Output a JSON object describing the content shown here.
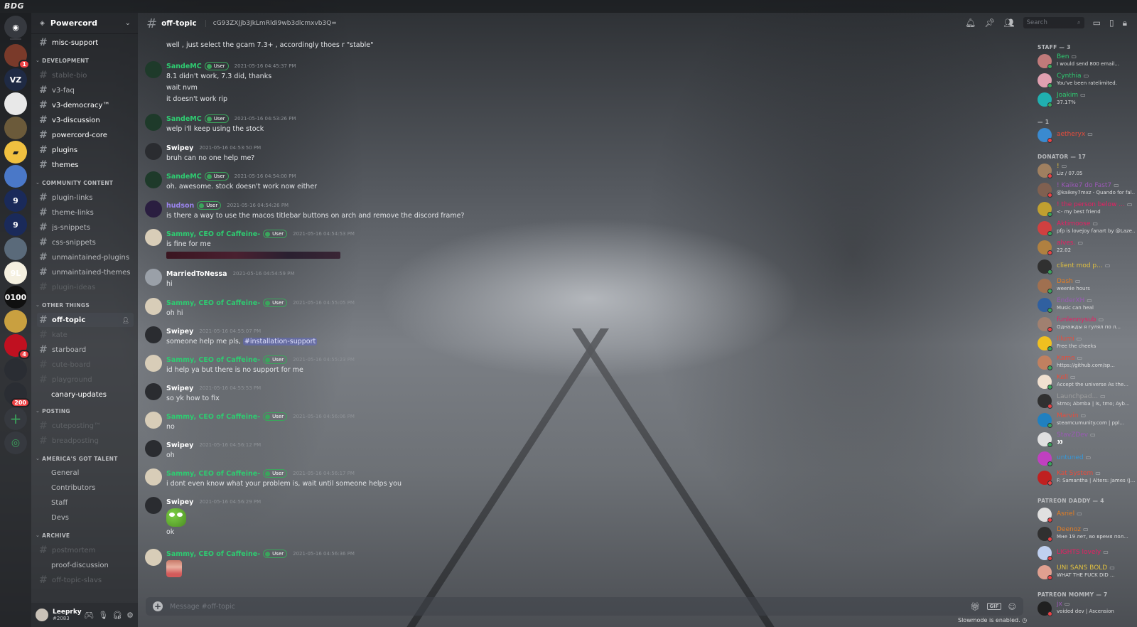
{
  "app": {
    "title": "BDG"
  },
  "colors": {
    "accent": "#5865f2",
    "online": "#3ba55c",
    "dnd": "#ed4245",
    "user_tag": "#3ba55c"
  },
  "guilds": [
    {
      "id": "home",
      "icon": "discord-icon",
      "color": "#36393f"
    },
    {
      "id": "g1",
      "color": "#7a3a2a",
      "badge": "1"
    },
    {
      "id": "g2",
      "label": "VZ",
      "color": "#1f2a44"
    },
    {
      "id": "g3",
      "color": "#e8e8e8"
    },
    {
      "id": "g4",
      "color": "#6b5a3a"
    },
    {
      "id": "g5",
      "icon": "folder-icon",
      "color": "#f0c040"
    },
    {
      "id": "g6",
      "color": "#4a78c8"
    },
    {
      "id": "g7",
      "label": "9",
      "color": "#1a2a5a"
    },
    {
      "id": "g8",
      "label": "9",
      "color": "#1a2a5a"
    },
    {
      "id": "g9",
      "color": "#5a6a7a"
    },
    {
      "id": "g10",
      "label": "9L",
      "color": "#f5f0e0"
    },
    {
      "id": "g11",
      "label": "0100",
      "color": "#101010"
    },
    {
      "id": "g12",
      "color": "#c9a040"
    },
    {
      "id": "g13",
      "color": "#c01020",
      "badge": "4"
    },
    {
      "id": "g14",
      "color": "#2a2d33"
    },
    {
      "id": "g15",
      "color": "#2a2d33",
      "badge": "200"
    }
  ],
  "server": {
    "name": "Powercord"
  },
  "channels": [
    {
      "name": "misc-support",
      "style": "bright",
      "hash": true
    },
    {
      "category": "DEVELOPMENT"
    },
    {
      "name": "stable-bio",
      "style": "muted",
      "hash": true
    },
    {
      "name": "v3-faq",
      "style": "normal",
      "hash": true
    },
    {
      "name": "v3-democracy™",
      "style": "bright",
      "hash": true
    },
    {
      "name": "v3-discussion",
      "style": "bright",
      "hash": true
    },
    {
      "name": "powercord-core",
      "style": "bright",
      "hash": true
    },
    {
      "name": "plugins",
      "style": "bright",
      "hash": true
    },
    {
      "name": "themes",
      "style": "bright",
      "hash": true
    },
    {
      "category": "COMMUNITY CONTENT"
    },
    {
      "name": "plugin-links",
      "style": "normal",
      "hash": true
    },
    {
      "name": "theme-links",
      "style": "normal",
      "hash": true
    },
    {
      "name": "js-snippets",
      "style": "normal",
      "hash": true
    },
    {
      "name": "css-snippets",
      "style": "normal",
      "hash": true
    },
    {
      "name": "unmaintained-plugins",
      "style": "normal",
      "hash": true
    },
    {
      "name": "unmaintained-themes",
      "style": "normal",
      "hash": true
    },
    {
      "name": "plugin-ideas",
      "style": "muted",
      "hash": true
    },
    {
      "category": "OTHER THINGS"
    },
    {
      "name": "off-topic",
      "style": "active",
      "hash": true
    },
    {
      "name": "kate",
      "style": "muted",
      "hash": true
    },
    {
      "name": "starboard",
      "style": "normal",
      "hash": true
    },
    {
      "name": "cute-board",
      "style": "muted",
      "hash": true
    },
    {
      "name": "playground",
      "style": "muted",
      "hash": true
    },
    {
      "name": "canary-updates",
      "style": "bright",
      "hash": false
    },
    {
      "category": "POSTING"
    },
    {
      "name": "cuteposting™",
      "style": "muted",
      "hash": true
    },
    {
      "name": "breadposting",
      "style": "muted",
      "hash": true
    },
    {
      "category": "AMERICA'S GOT TALENT"
    },
    {
      "name": "General",
      "style": "normal",
      "hash": false
    },
    {
      "name": "Contributors",
      "style": "normal",
      "hash": false
    },
    {
      "name": "Staff",
      "style": "normal",
      "hash": false
    },
    {
      "name": "Devs",
      "style": "normal",
      "hash": false
    },
    {
      "category": "ARCHIVE"
    },
    {
      "name": "postmortem",
      "style": "muted",
      "hash": true
    },
    {
      "name": "proof-discussion",
      "style": "normal",
      "hash": false
    },
    {
      "name": "off-topic-slavs",
      "style": "muted",
      "hash": true
    }
  ],
  "user_panel": {
    "username": "Leeprky",
    "discriminator": "#2083"
  },
  "header": {
    "channel": "off-topic",
    "topic": "cG93ZXJjb3JkLmRldi9wb3dlcmxvb3Q=",
    "search_placeholder": "Search"
  },
  "messages": [
    {
      "author": "",
      "lines": [
        "well , just select the gcam 7.3+ , accordingly thoes r \"stable\""
      ],
      "continuation": true
    },
    {
      "author": "SandeMC",
      "color": "green",
      "tag": "User",
      "ts": "2021-05-16 04:45:37 PM",
      "avatar": "#1e3a2a",
      "lines": [
        "8.1 didn't work, 7.3 did, thanks",
        "wait nvm",
        "it doesn't work rip"
      ]
    },
    {
      "author": "SandeMC",
      "color": "green",
      "tag": "User",
      "ts": "2021-05-16 04:53:26 PM",
      "avatar": "#1e3a2a",
      "lines": [
        "welp i'll keep using the stock"
      ]
    },
    {
      "author": "Swipey",
      "color": "white",
      "ts": "2021-05-16 04:53:50 PM",
      "avatar": "#2a2c30",
      "lines": [
        "bruh can no one help me?"
      ]
    },
    {
      "author": "SandeMC",
      "color": "green",
      "tag": "User",
      "ts": "2021-05-16 04:54:00 PM",
      "avatar": "#1e3a2a",
      "lines": [
        "oh. awesome. stock doesn't work now either"
      ]
    },
    {
      "author": "hudson",
      "color": "purple",
      "tag": "User",
      "ts": "2021-05-16 04:54:26 PM",
      "avatar": "#2a1e40",
      "lines": [
        "is there a way to use the macos titlebar buttons on arch and remove the discord frame?"
      ]
    },
    {
      "author": "Sammy, CEO of Caffeine-",
      "color": "green",
      "tag": "User",
      "ts": "2021-05-16 04:54:53 PM",
      "avatar": "#d8cdb8",
      "lines": [
        "is fine for me"
      ],
      "attachment": "screenshot"
    },
    {
      "author": "MarriedToNessa",
      "color": "white",
      "ts": "2021-05-16 04:54:59 PM",
      "avatar": "#9aa0a8",
      "lines": [
        "hi"
      ]
    },
    {
      "author": "Sammy, CEO of Caffeine-",
      "color": "green",
      "tag": "User",
      "ts": "2021-05-16 04:55:05 PM",
      "avatar": "#d8cdb8",
      "lines": [
        "oh hi"
      ]
    },
    {
      "author": "Swipey",
      "color": "white",
      "ts": "2021-05-16 04:55:07 PM",
      "avatar": "#2a2c30",
      "lines": [
        "someone help me pls, "
      ],
      "mention": "#installation-support"
    },
    {
      "author": "Sammy, CEO of Caffeine-",
      "color": "green",
      "tag": "User",
      "ts": "2021-05-16 04:55:23 PM",
      "avatar": "#d8cdb8",
      "lines": [
        "id help ya but there is no support for me"
      ]
    },
    {
      "author": "Swipey",
      "color": "white",
      "ts": "2021-05-16 04:55:53 PM",
      "avatar": "#2a2c30",
      "lines": [
        "so yk how to fix"
      ]
    },
    {
      "author": "Sammy, CEO of Caffeine-",
      "color": "green",
      "tag": "User",
      "ts": "2021-05-16 04:56:06 PM",
      "avatar": "#d8cdb8",
      "lines": [
        "no"
      ]
    },
    {
      "author": "Swipey",
      "color": "white",
      "ts": "2021-05-16 04:56:12 PM",
      "avatar": "#2a2c30",
      "lines": [
        "oh"
      ]
    },
    {
      "author": "Sammy, CEO of Caffeine-",
      "color": "green",
      "tag": "User",
      "ts": "2021-05-16 04:56:17 PM",
      "avatar": "#d8cdb8",
      "lines": [
        "i dont even know what your problem is, wait until someone helps you"
      ]
    },
    {
      "author": "Swipey",
      "color": "white",
      "ts": "2021-05-16 04:56:29 PM",
      "avatar": "#2a2c30",
      "emoji": "pepe",
      "lines": [
        "ok"
      ]
    },
    {
      "author": "Sammy, CEO of Caffeine-",
      "color": "green",
      "tag": "User",
      "ts": "2021-05-16 04:56:36 PM",
      "avatar": "#d8cdb8",
      "emoji": "face",
      "lines": []
    }
  ],
  "composer": {
    "placeholder": "Message #off-topic",
    "slowmode": "Slowmode is enabled."
  },
  "members": [
    {
      "category": "STAFF — 3"
    },
    {
      "name": "Ben",
      "color": "#2ecc71",
      "status": "I would send 800 email...",
      "avatar": "#c07a7a",
      "st": "online"
    },
    {
      "name": "Cynthia",
      "color": "#2ecc71",
      "status": "You've been ratelimited.",
      "avatar": "#e0a0b0",
      "st": "online"
    },
    {
      "name": "Joakim",
      "color": "#2ecc71",
      "status": "37.17%",
      "avatar": "#20b0b0",
      "st": "online"
    },
    {
      "category": "— 1"
    },
    {
      "name": "aetheryx",
      "color": "#e74c3c",
      "status": "",
      "avatar": "#3a8ad0",
      "st": "dnd"
    },
    {
      "category": "DONATOR — 17"
    },
    {
      "name": "!",
      "color": "#e0c040",
      "status": "Liz / 07.05",
      "avatar": "#a08060",
      "st": "dnd"
    },
    {
      "name": "! Kaike7 do Fast7",
      "color": "#9b59b6",
      "status": "@kaikey7mxz - Quando for fal...",
      "avatar": "#806050",
      "st": "dnd"
    },
    {
      "name": "! the person below ...",
      "color": "#e91e63",
      "status": "<- my best friend",
      "avatar": "#c0a030",
      "st": "online"
    },
    {
      "name": "Aktimoose",
      "color": "#e91e63",
      "status": "pfp is lovejoy fanart by @Laze...",
      "avatar": "#d04040",
      "st": "online"
    },
    {
      "name": "alves.",
      "color": "#e91e63",
      "status": "22.02",
      "avatar": "#b08040",
      "st": "dnd"
    },
    {
      "name": "client mod p...",
      "color": "#e0c040",
      "status": "",
      "avatar": "#303030",
      "st": "online"
    },
    {
      "name": "Dash",
      "color": "#e67e22",
      "status": "weenie hours",
      "avatar": "#a07050",
      "st": "online"
    },
    {
      "name": "EnderXH",
      "color": "#9b59b6",
      "status": "Music can heal",
      "avatar": "#3060a0",
      "st": "online"
    },
    {
      "name": "funlennysub",
      "color": "#e91e63",
      "status": "Однажды я гулял по л...",
      "avatar": "#a08070",
      "st": "dnd"
    },
    {
      "name": "Illumi",
      "color": "#e74c3c",
      "status": "Free the cheeks",
      "avatar": "#f0c020",
      "st": "online"
    },
    {
      "name": "Kamo",
      "color": "#e74c3c",
      "status": "https://github.com/sp...",
      "avatar": "#c08060",
      "st": "online"
    },
    {
      "name": "Kell",
      "color": "#e74c3c",
      "status": "Accept the universe As the...",
      "avatar": "#f0e0d0",
      "st": "online"
    },
    {
      "name": "Launchpad...",
      "color": "#9e9e9e",
      "status": "Stmo; Abmba | Is, tmo; Ayb...",
      "avatar": "#303030",
      "st": "dnd"
    },
    {
      "name": "Marvin",
      "color": "#e74c3c",
      "status": "steamcumunity.com | ppl...",
      "avatar": "#2080c0",
      "st": "online"
    },
    {
      "name": "StavZDev",
      "color": "#9b59b6",
      "status": "👀",
      "avatar": "#e0e0e0",
      "st": "online"
    },
    {
      "name": "untuned",
      "color": "#3498db",
      "status": "",
      "avatar": "#c040c0",
      "st": "online"
    },
    {
      "name": "Kat System",
      "color": "#e74c3c",
      "status": "F: Samantha | Alters: James (J...",
      "avatar": "#c02020",
      "st": "dnd"
    },
    {
      "category": "PATREON DADDY — 4"
    },
    {
      "name": "Asriel",
      "color": "#e67e22",
      "status": "",
      "avatar": "#e0e0e0",
      "st": "dnd"
    },
    {
      "name": "Deenoz",
      "color": "#e67e22",
      "status": "Мне 19 лет, во время пол...",
      "avatar": "#303030",
      "st": "dnd"
    },
    {
      "name": "LIGHTS lovely",
      "color": "#e91e63",
      "status": "",
      "avatar": "#c0d0f0",
      "st": "dnd"
    },
    {
      "name": "UNI SANS BOLD",
      "color": "#e0c040",
      "status": "WHAT THE FUCK DID ...",
      "avatar": "#e0a090",
      "st": "dnd"
    },
    {
      "category": "PATREON MOMMY — 7"
    },
    {
      "name": "jx",
      "color": "#9b59b6",
      "status": "voided dev | Ascension",
      "avatar": "#202020",
      "st": "dnd"
    }
  ]
}
